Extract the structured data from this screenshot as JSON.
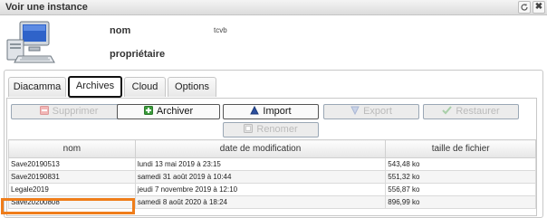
{
  "window": {
    "title": "Voir une instance",
    "refresh_icon": "refresh-icon",
    "close_label": "✖"
  },
  "instance": {
    "name_label": "nom",
    "name_value": "tcvb",
    "owner_label": "propriétaire",
    "owner_value": "",
    "icon": "computer-icon"
  },
  "tabs": [
    {
      "label": "Diacamma",
      "active": false
    },
    {
      "label": "Archives",
      "active": true
    },
    {
      "label": "Cloud",
      "active": false
    },
    {
      "label": "Options",
      "active": false
    }
  ],
  "toolbar": {
    "delete_label": "Supprimer",
    "archive_label": "Archiver",
    "import_label": "Import",
    "export_label": "Export",
    "restore_label": "Restaurer",
    "rename_label": "Renomer"
  },
  "table": {
    "columns": [
      "nom",
      "date de modification",
      "taille de fichier"
    ],
    "rows": [
      [
        "Save20190513",
        "lundi 13 mai 2019 à 23:15",
        "543,48 ko"
      ],
      [
        "Save20190831",
        "samedi 31 août 2019 à 10:44",
        "551,32 ko"
      ],
      [
        "Legale2019",
        "jeudi 7 novembre 2019 à 12:10",
        "556,87 ko"
      ],
      [
        "Save20200808",
        "samedi 8 août 2020 à 18:24",
        "896,99 ko"
      ]
    ],
    "highlighted_row": 3
  },
  "colors": {
    "highlight": "#ef7d1a",
    "active_tab_border": "#111111"
  }
}
